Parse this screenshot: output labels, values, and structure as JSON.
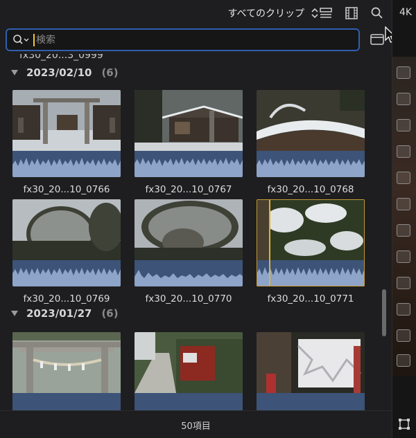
{
  "toolbar": {
    "filter_label": "すべてのクリップ",
    "filter_chevron_icon": "up-down-chevron-icon",
    "list_view_icon": "list-view-icon",
    "filmstrip_icon": "filmstrip-icon",
    "search_icon": "search-icon"
  },
  "right_panel": {
    "label": "4K"
  },
  "search": {
    "placeholder": "検索",
    "value": ""
  },
  "list": {
    "partial_clip_name": "fx30_20...3_0999",
    "groups": [
      {
        "date": "2023/02/10",
        "count": "(6)",
        "clips": [
          {
            "name": "fx30_20...10_0766"
          },
          {
            "name": "fx30_20...10_0767"
          },
          {
            "name": "fx30_20...10_0768"
          },
          {
            "name": "fx30_20...10_0769"
          },
          {
            "name": "fx30_20...10_0770"
          },
          {
            "name": "fx30_20...10_0771"
          }
        ]
      },
      {
        "date": "2023/01/27",
        "count": "(6)",
        "clips": [
          {
            "name": ""
          },
          {
            "name": ""
          },
          {
            "name": ""
          }
        ]
      }
    ]
  },
  "footer": {
    "item_count": "50項目"
  },
  "colors": {
    "background": "#1e1e20",
    "search_focus": "#2f5fb0",
    "audio_waveform_bg": "#3d5378",
    "audio_waveform": "#8ea4c8",
    "playhead": "#e0b43a"
  }
}
